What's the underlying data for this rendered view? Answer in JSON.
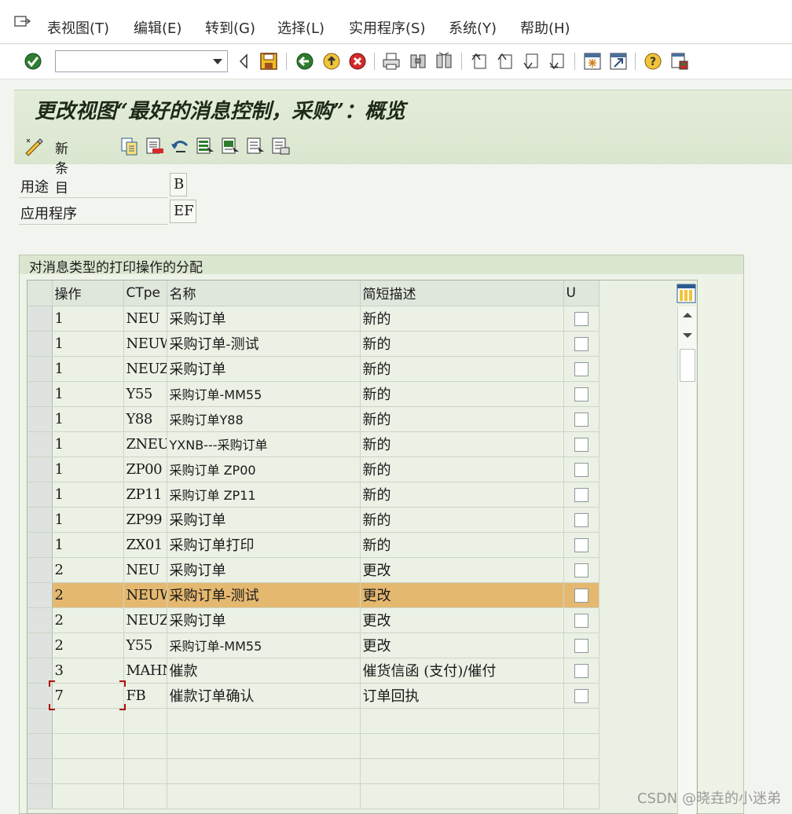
{
  "menu": {
    "items": [
      "表视图(T)",
      "编辑(E)",
      "转到(G)",
      "选择(L)",
      "实用程序(S)",
      "系统(Y)",
      "帮助(H)"
    ]
  },
  "toolbar": {
    "command_value": "",
    "icons": [
      "enter-icon",
      "back-icon",
      "save-icon",
      "green-arrow-icon",
      "exit-icon",
      "cancel-icon",
      "print-icon",
      "find-icon",
      "find-next-icon",
      "first-page-icon",
      "previous-page-icon",
      "next-page-icon",
      "last-page-icon",
      "create-session-icon",
      "shortcut-icon",
      "help-icon",
      "layout-icon"
    ]
  },
  "title": "更改视图“最好的消息控制，采购”：概览",
  "app_toolbar": {
    "new_entries_label": "新条目"
  },
  "fields": [
    {
      "label": "用途",
      "value": "B"
    },
    {
      "label": "应用程序",
      "value": "EF"
    }
  ],
  "group": {
    "title": "对消息类型的打印操作的分配",
    "columns": [
      "操作",
      "CTpe",
      "名称",
      "简短描述",
      "U"
    ],
    "rows": [
      {
        "op": "1",
        "ctype": "NEU",
        "name": "采购订单",
        "desc": "新的",
        "u": false
      },
      {
        "op": "1",
        "ctype": "NEUW",
        "name": "采购订单-测试",
        "desc": "新的",
        "u": false
      },
      {
        "op": "1",
        "ctype": "NEUZ",
        "name": "采购订单",
        "desc": "新的",
        "u": false
      },
      {
        "op": "1",
        "ctype": "Y55",
        "name": "采购订单-MM55",
        "desc": "新的",
        "u": false
      },
      {
        "op": "1",
        "ctype": "Y88",
        "name": "采购订单Y88",
        "desc": "新的",
        "u": false
      },
      {
        "op": "1",
        "ctype": "ZNEU",
        "name": "YXNB---采购订单",
        "desc": "新的",
        "u": false
      },
      {
        "op": "1",
        "ctype": "ZP00",
        "name": "采购订单  ZP00",
        "desc": "新的",
        "u": false
      },
      {
        "op": "1",
        "ctype": "ZP11",
        "name": "采购订单  ZP11",
        "desc": "新的",
        "u": false
      },
      {
        "op": "1",
        "ctype": "ZP99",
        "name": "采购订单",
        "desc": "新的",
        "u": false
      },
      {
        "op": "1",
        "ctype": "ZX01",
        "name": "采购订单打印",
        "desc": "新的",
        "u": false
      },
      {
        "op": "2",
        "ctype": "NEU",
        "name": "采购订单",
        "desc": "更改",
        "u": false
      },
      {
        "op": "2",
        "ctype": "NEUW",
        "name": "采购订单-测试",
        "desc": "更改",
        "u": false,
        "highlight": true
      },
      {
        "op": "2",
        "ctype": "NEUZ",
        "name": "采购订单",
        "desc": "更改",
        "u": false
      },
      {
        "op": "2",
        "ctype": "Y55",
        "name": "采购订单-MM55",
        "desc": "更改",
        "u": false
      },
      {
        "op": "3",
        "ctype": "MAHN",
        "name": "催款",
        "desc": "催货信函 (支付)/催付",
        "u": false
      },
      {
        "op": "7",
        "ctype": "FB",
        "name": "催款订单确认",
        "desc": "订单回执",
        "u": false
      }
    ],
    "empty_rows": 4
  },
  "watermark": "CSDN @晓垚的小迷弟"
}
